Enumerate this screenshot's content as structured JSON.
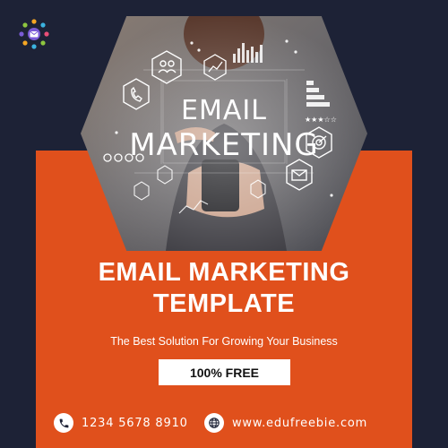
{
  "colors": {
    "navy": "#1d2236",
    "orange": "#e0501c",
    "white": "#ffffff"
  },
  "logo": {
    "icon": "envelope-network-icon"
  },
  "hero": {
    "icon_names": [
      "people-icon",
      "chart-icon",
      "phone-icon",
      "target-icon",
      "envelope-icon",
      "star-rating-icon"
    ],
    "line1": "EMAIL",
    "line2": "MARKETING"
  },
  "title": {
    "line1": "EMAIL MARKETING",
    "line2": "TEMPLATE"
  },
  "subtitle": "The Best Solution For Growing Your Business",
  "badge": "100% FREE",
  "contact": {
    "phone": "1234 5678 8910",
    "phone_icon": "phone-icon",
    "website": "www.edufreebie.com",
    "website_icon": "globe-icon"
  }
}
